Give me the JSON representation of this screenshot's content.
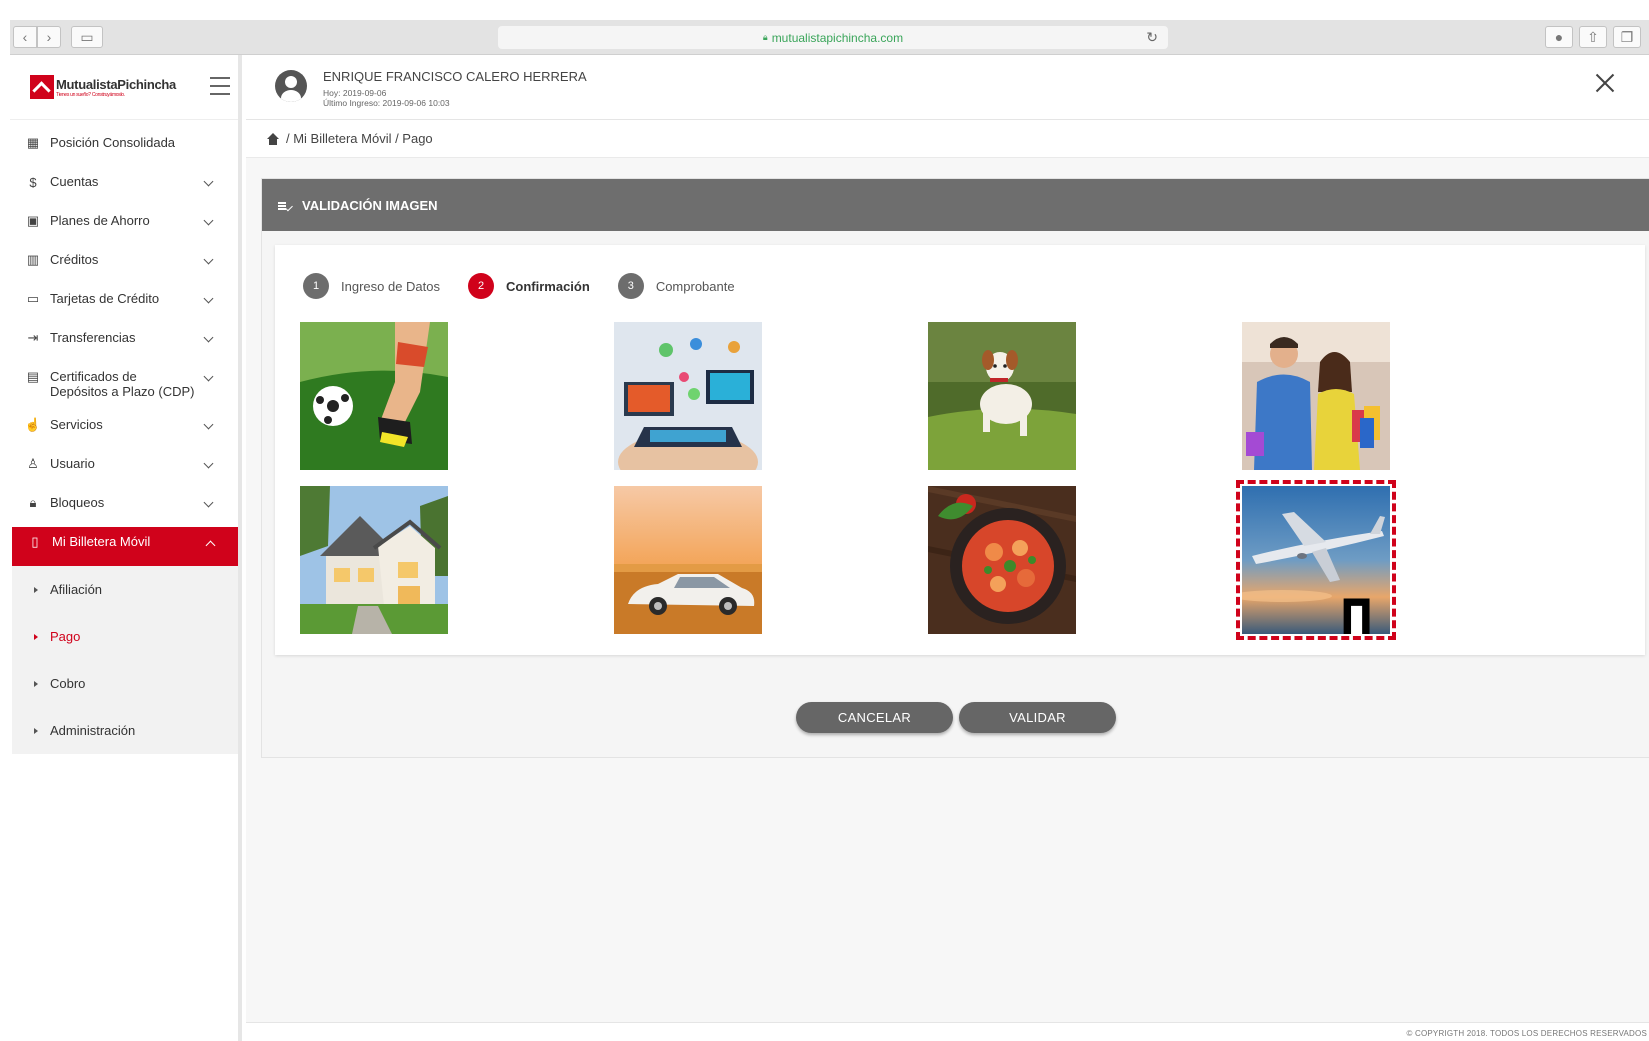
{
  "browser": {
    "url": "mutualistapichincha.com",
    "lock_icon": "lock-icon",
    "reload_icon": "reload-icon"
  },
  "brand": {
    "name": "MutualistaPichincha",
    "tagline": "Tienes un sueño? Construyámoslo.",
    "color": "#d0021b"
  },
  "user": {
    "name": "ENRIQUE FRANCISCO CALERO HERRERA",
    "today": "Hoy: 2019-09-06",
    "last_login": "Último Ingreso: 2019-09-06 10:03"
  },
  "sidebar": {
    "items": [
      {
        "label": "Posición Consolidada",
        "icon": "grid-icon"
      },
      {
        "label": "Cuentas",
        "icon": "dollar-circle-icon"
      },
      {
        "label": "Planes de Ahorro",
        "icon": "briefcase-icon"
      },
      {
        "label": "Créditos",
        "icon": "building-icon"
      },
      {
        "label": "Tarjetas de Crédito",
        "icon": "credit-card-icon"
      },
      {
        "label": "Transferencias",
        "icon": "transfer-icon"
      },
      {
        "label": "Certificados de\nDepósitos a Plazo (CDP)",
        "icon": "document-icon"
      },
      {
        "label": "Servicios",
        "icon": "hand-icon"
      },
      {
        "label": "Usuario",
        "icon": "user-icon"
      },
      {
        "label": "Bloqueos",
        "icon": "lock-icon"
      },
      {
        "label": "Mi Billetera Móvil",
        "icon": "mobile-icon"
      }
    ],
    "subitems": [
      {
        "label": "Afiliación"
      },
      {
        "label": "Pago"
      },
      {
        "label": "Cobro"
      },
      {
        "label": "Administración"
      }
    ]
  },
  "breadcrumb": {
    "home_icon": "home-icon",
    "path": "/ Mi Billetera Móvil / Pago"
  },
  "panel": {
    "title": "VALIDACIÓN IMAGEN"
  },
  "steps": [
    {
      "num": "1",
      "label": "Ingreso de Datos"
    },
    {
      "num": "2",
      "label": "Confirmación"
    },
    {
      "num": "3",
      "label": "Comprobante"
    }
  ],
  "images": [
    {
      "subject": "soccer"
    },
    {
      "subject": "technology"
    },
    {
      "subject": "dog"
    },
    {
      "subject": "shopping-couple"
    },
    {
      "subject": "house"
    },
    {
      "subject": "car-sunset"
    },
    {
      "subject": "pasta"
    },
    {
      "subject": "airplane",
      "selected": true
    }
  ],
  "buttons": {
    "cancel": "CANCELAR",
    "validate": "VALIDAR"
  },
  "footer": {
    "copyright": "© COPYRIGTH 2018. TODOS LOS DERECHOS RESERVADOS"
  }
}
